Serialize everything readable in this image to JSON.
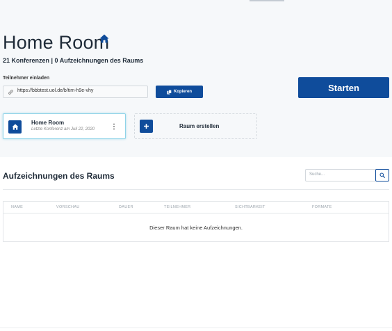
{
  "room": {
    "title": "Home Room",
    "stats": "21 Konferenzen | 0 Aufzeichnungen des Raums"
  },
  "invite": {
    "label": "Teilnehmer einladen",
    "url": "https://bbbtest.uol.de/b/tim-h9e-vhy",
    "copy_label": "Kopieren"
  },
  "start_label": "Starten",
  "room_card": {
    "name": "Home Room",
    "last_session": "Letzte Konferenz am Juli 22, 2020"
  },
  "new_room_label": "Raum erstellen",
  "recordings": {
    "title": "Aufzeichnungen des Raums",
    "search_placeholder": "Suche...",
    "columns": [
      "NAME",
      "VORSCHAU",
      "DAUER",
      "TEILNEHMER",
      "SICHTBARKEIT",
      "FORMATE"
    ],
    "empty_message": "Dieser Raum hat keine Aufzeichnungen."
  },
  "colors": {
    "primary": "#0f4c9b",
    "card_highlight": "#8fd3e8",
    "background": "#f6f8fa"
  },
  "icons": {
    "title": "home-icon",
    "invite": "link-icon",
    "copy": "copy-icon",
    "card": "home-icon",
    "card_menu": "more-vertical-icon",
    "new_room": "plus-icon",
    "search": "search-icon"
  }
}
